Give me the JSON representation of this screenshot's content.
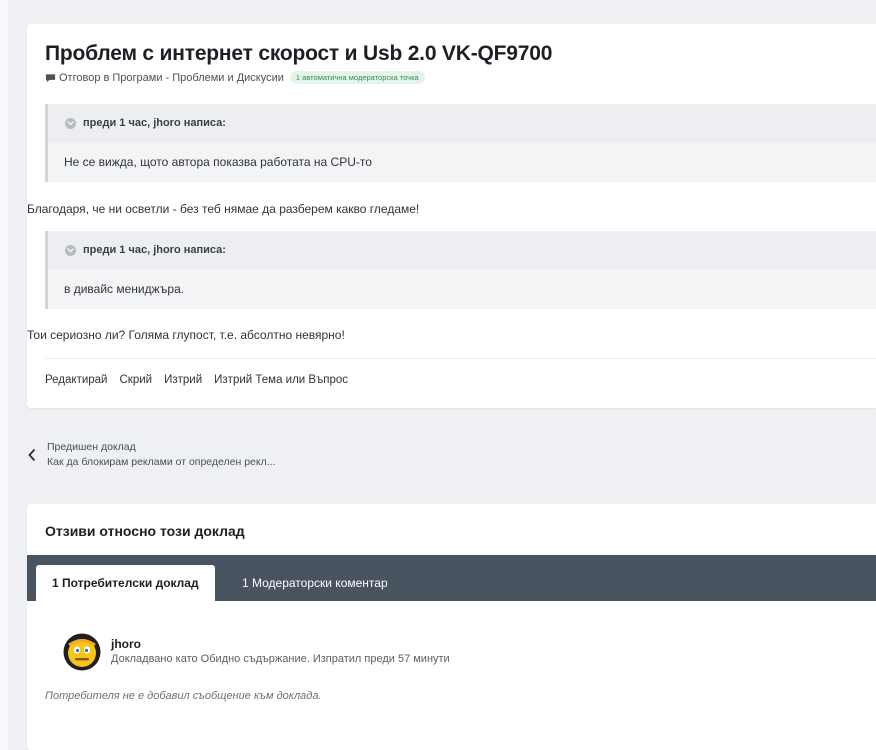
{
  "report": {
    "title": "Проблем с интернет скорост и Usb 2.0 VK-QF9700",
    "meta_text": "Отговор в Програми - Проблеми и Дискусии",
    "badge": "1 автоматична модераторска точка",
    "quote1": {
      "header": "преди 1 час, jhoro написа:",
      "body": "Не се вижда, щото автора показва работата на CPU-то"
    },
    "paragraph1": "Благодаря, че ни осветли - без теб нямае да разберем какво гледаме!",
    "quote2": {
      "header": "преди 1 час, jhoro написа:",
      "body": "в дивайс мениджъра."
    },
    "paragraph2": "Тои сериозно ли? Голяма глупост, т.е. абсолтно невярно!",
    "actions": {
      "edit": "Редактирай",
      "hide": "Скрий",
      "delete": "Изтрий",
      "delete_topic": "Изтрий Тема или Въпрос"
    }
  },
  "prev_report": {
    "label": "Предишен доклад",
    "title": "Как да блокирам реклами от определен рекл..."
  },
  "feedback": {
    "title": "Отзиви относно този доклад",
    "tabs": [
      {
        "label": "1 Потребителски доклад"
      },
      {
        "label": "1 Модераторски коментар"
      }
    ],
    "entry": {
      "user": "jhoro",
      "meta": "Докладвано като Обидно съдържание. Изпратил преди 57 минути",
      "no_message": "Потребителя не е добавил съобщение към доклада."
    }
  },
  "colors": {
    "tabbar": "#4a5460",
    "badge_bg": "#e5f4ea",
    "badge_text": "#3d8a55"
  },
  "icons": {
    "meta": "comment-bubble-icon",
    "quote": "quote-circle-icon",
    "prev": "chevron-left-icon",
    "avatar": "emoji-avatar"
  }
}
